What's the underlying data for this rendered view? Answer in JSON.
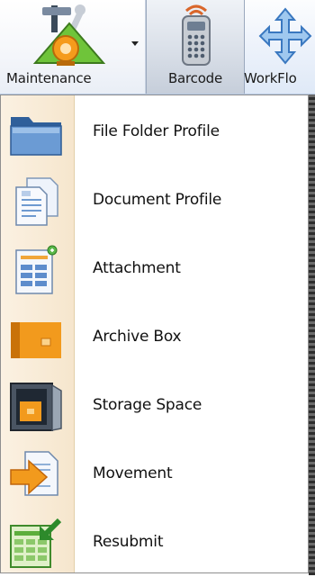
{
  "ribbon": {
    "buttons": [
      {
        "label": "Maintenance",
        "icon": "maintenance-tools-icon",
        "has_dropdown": true
      },
      {
        "label": "Barcode",
        "icon": "barcode-remote-icon",
        "state": "pressed"
      },
      {
        "label": "WorkFlo",
        "icon": "workflow-arrows-icon"
      }
    ]
  },
  "menu": {
    "items": [
      {
        "label": "File Folder Profile",
        "icon": "file-folder-icon"
      },
      {
        "label": "Document Profile",
        "icon": "document-profile-icon"
      },
      {
        "label": "Attachment",
        "icon": "attachment-icon"
      },
      {
        "label": "Archive Box",
        "icon": "archive-box-icon"
      },
      {
        "label": "Storage Space",
        "icon": "storage-space-icon"
      },
      {
        "label": "Movement",
        "icon": "movement-icon"
      },
      {
        "label": "Resubmit",
        "icon": "resubmit-icon"
      }
    ]
  },
  "colors": {
    "ribbon_bg": "#e8eef8",
    "menu_strip": "#f7e8d2",
    "menu_border": "#8f8f8f"
  }
}
